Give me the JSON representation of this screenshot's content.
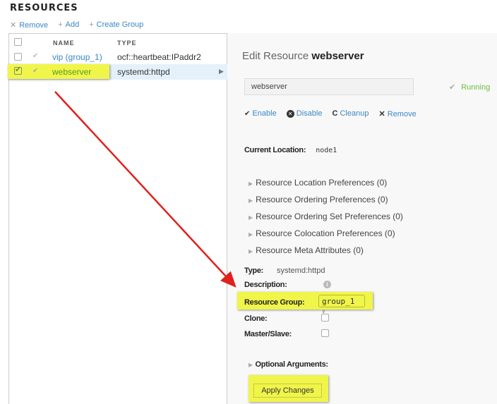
{
  "title": "RESOURCES",
  "toolbar": {
    "remove": "Remove",
    "add": "Add",
    "create_group": "Create Group"
  },
  "table": {
    "headers": [
      "NAME",
      "TYPE"
    ],
    "rows": [
      {
        "name": "vip (group_1)",
        "type": "ocf::heartbeat:IPaddr2",
        "checked": false,
        "selected": false
      },
      {
        "name": "webserver",
        "type": "systemd:httpd",
        "checked": true,
        "selected": true
      }
    ]
  },
  "edit": {
    "heading_prefix": "Edit Resource",
    "heading_name": "webserver",
    "name_value": "webserver",
    "status": "Running",
    "actions": {
      "enable": "Enable",
      "disable": "Disable",
      "cleanup": "Cleanup",
      "remove": "Remove"
    },
    "current_location_label": "Current Location:",
    "current_location": "node1",
    "preferences": [
      "Resource Location Preferences (0)",
      "Resource Ordering Preferences (0)",
      "Resource Ordering Set Preferences (0)",
      "Resource Colocation Preferences (0)",
      "Resource Meta Attributes (0)"
    ],
    "type_label": "Type:",
    "type_value": "systemd:httpd",
    "description_label": "Description:",
    "group_label": "Resource Group:",
    "group_value": "group_1",
    "clone_label": "Clone:",
    "master_label": "Master/Slave:",
    "optional_label": "Optional Arguments:",
    "apply": "Apply Changes"
  },
  "colors": {
    "link": "#3a87c8",
    "running": "#6bbf3a",
    "highlight": "#f0f54a",
    "arrow": "#e0201c"
  }
}
